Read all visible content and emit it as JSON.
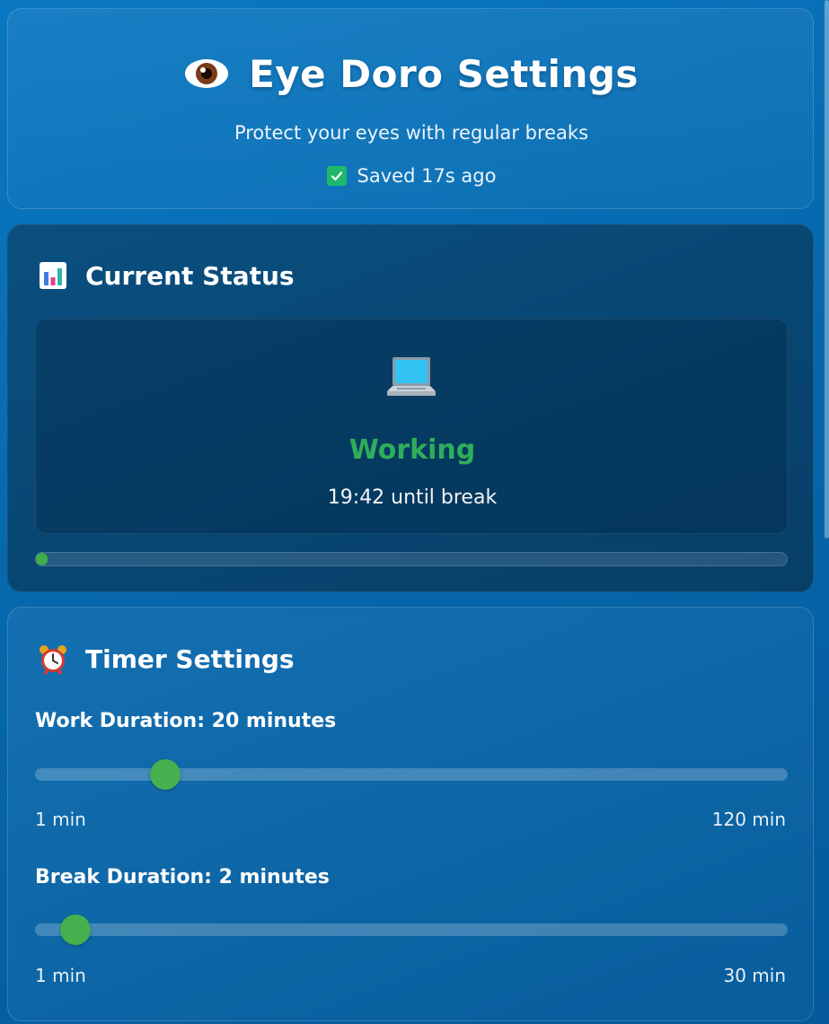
{
  "header": {
    "icon": "eye-icon",
    "title": "Eye Doro Settings",
    "subtitle": "Protect your eyes with regular breaks",
    "saved_icon": "check-icon",
    "saved_text": "Saved 17s ago"
  },
  "status": {
    "icon": "bar-chart-icon",
    "heading": "Current Status",
    "state_icon": "laptop-icon",
    "state_label": "Working",
    "time_text": "19:42 until break",
    "progress_percent": 1.5,
    "colors": {
      "state": "#2fae5a",
      "progress": "#3fae4a"
    }
  },
  "timer": {
    "icon": "alarm-clock-icon",
    "heading": "Timer Settings",
    "work": {
      "label": "Work Duration: 20 minutes",
      "value": 20,
      "min": 1,
      "max": 120,
      "min_label": "1 min",
      "max_label": "120 min"
    },
    "break": {
      "label": "Break Duration: 2 minutes",
      "value": 2,
      "min": 1,
      "max": 30,
      "min_label": "1 min",
      "max_label": "30 min"
    },
    "colors": {
      "thumb": "#45b04d"
    }
  }
}
